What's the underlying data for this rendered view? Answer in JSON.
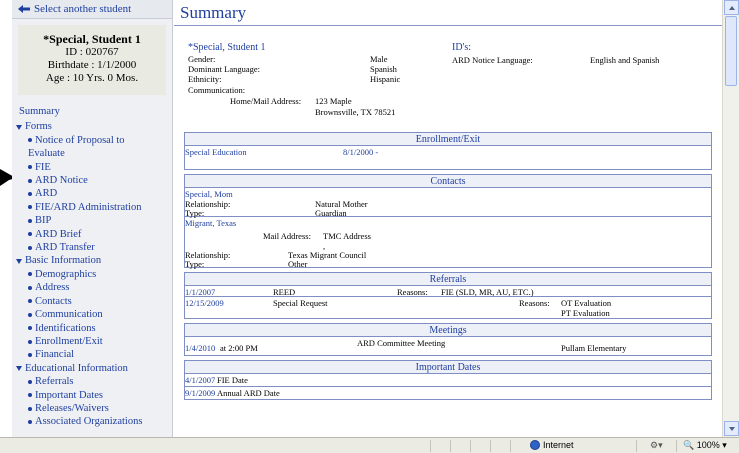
{
  "sidebar": {
    "select_student": "Select another student",
    "student": {
      "name": "*Special, Student 1",
      "id": "ID : 020767",
      "birthdate": "Birthdate : 1/1/2000",
      "age": "Age : 10 Yrs. 0 Mos."
    },
    "summary": "Summary",
    "forms": {
      "label": "Forms",
      "items": [
        "Notice of Proposal to Evaluate",
        "FIE",
        "ARD Notice",
        "ARD",
        "FIE/ARD Administration",
        "BIP",
        "ARD Brief",
        "ARD Transfer"
      ]
    },
    "basic": {
      "label": "Basic Information",
      "items": [
        "Demographics",
        "Address",
        "Contacts",
        "Communication",
        "Identifications",
        "Enrollment/Exit",
        "Financial"
      ]
    },
    "educational": {
      "label": "Educational Information",
      "items": [
        "Referrals",
        "Important Dates",
        "Releases/Waivers",
        "Associated Organizations"
      ]
    }
  },
  "main": {
    "title": "Summary",
    "info": {
      "name": "*Special, Student 1",
      "gender_label": "Gender:",
      "gender": "Male",
      "language_label": "Dominant Language:",
      "language": "Spanish",
      "ethnicity_label": "Ethnicity:",
      "ethnicity": "Hispanic",
      "communication_label": "Communication:",
      "ids_label": "ID's:",
      "ard_lang_label": "ARD Notice Language:",
      "ard_lang": "English and Spanish",
      "address_label": "Home/Mail Address:",
      "address1": "123 Maple",
      "address2": "Brownsville, TX 78521"
    },
    "enrollment": {
      "header": "Enrollment/Exit",
      "program": "Special Education",
      "date": "8/1/2000  -"
    },
    "contacts": {
      "header": "Contacts",
      "c1": {
        "name": "Special, Mom",
        "rel_label": "Relationship:",
        "rel": "Natural Mother",
        "type_label": "Type:",
        "type": "Guardian"
      },
      "c2": {
        "name": "Migrant, Texas",
        "mail_label": "Mail Address:",
        "mail": "TMC Address",
        "comma": ",",
        "rel_label": "Relationship:",
        "rel": "Texas Migrant Council",
        "type_label": "Type:",
        "type": "Other"
      }
    },
    "referrals": {
      "header": "Referrals",
      "r1": {
        "date": "1/1/2007",
        "kind": "REED",
        "reasons_label": "Reasons:",
        "reasons": "FIE (SLD, MR, AU, ETC.)"
      },
      "r2": {
        "date": "12/15/2009",
        "kind": "Special Request",
        "reasons_label": "Reasons:",
        "reason1": "OT Evaluation",
        "reason2": "PT Evaluation"
      }
    },
    "meetings": {
      "header": "Meetings",
      "m1": {
        "date": "1/4/2010",
        "at": "at  2:00 PM",
        "kind": "ARD Committee Meeting",
        "place": "Pullam Elementary"
      }
    },
    "important_dates": {
      "header": "Important Dates",
      "d1": {
        "date": "4/1/2007",
        "label": "FIE Date"
      },
      "d2": {
        "date": "9/1/2009",
        "label": "Annual ARD Date"
      }
    }
  },
  "status_bar": {
    "zone": "Internet",
    "zoom": "100%"
  }
}
